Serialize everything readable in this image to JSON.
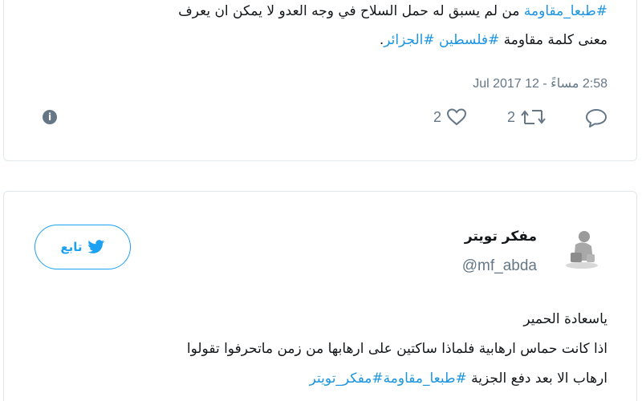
{
  "tweet1": {
    "line1_hashtag": "#طبعا_مقاومة",
    "line1_text": " من لم يسبق له حمل السلاح في وجه العدو لا يمكن ان يعرف",
    "line2_text": "معنى كلمة مقاومة ",
    "line2_hashtag1": "#فلسطين",
    "line2_hashtag2": " #الجزائر",
    "line2_end": ".",
    "timestamp": "2:58 مساءً - 12 Jul 2017",
    "likes_count": "2",
    "retweets_count": "2"
  },
  "tweet2": {
    "follow_label": "تابع",
    "display_name": "مفكر تويتر",
    "handle": "@mf_abda",
    "line1": "ياسعادة الحمير",
    "line2": "اذا كانت حماس ارهابية فلماذا ساكتين على ارهابها من زمن ماتحرفوا تقولوا",
    "line3_text": "ارهاب الا بعد دفع الجزية ",
    "line3_hashtag1": "#طبعا_مقاومة",
    "line3_hashtag2": "#مفكر_تويتر"
  },
  "icons": {
    "reply": "reply-icon",
    "retweet": "retweet-icon",
    "like": "heart-icon",
    "info": "info-icon",
    "bird": "twitter-bird-icon"
  },
  "colors": {
    "link": "#1b95e0",
    "twitter_blue": "#1da1f2",
    "secondary_text": "#657786",
    "border": "#e1e8ed"
  }
}
